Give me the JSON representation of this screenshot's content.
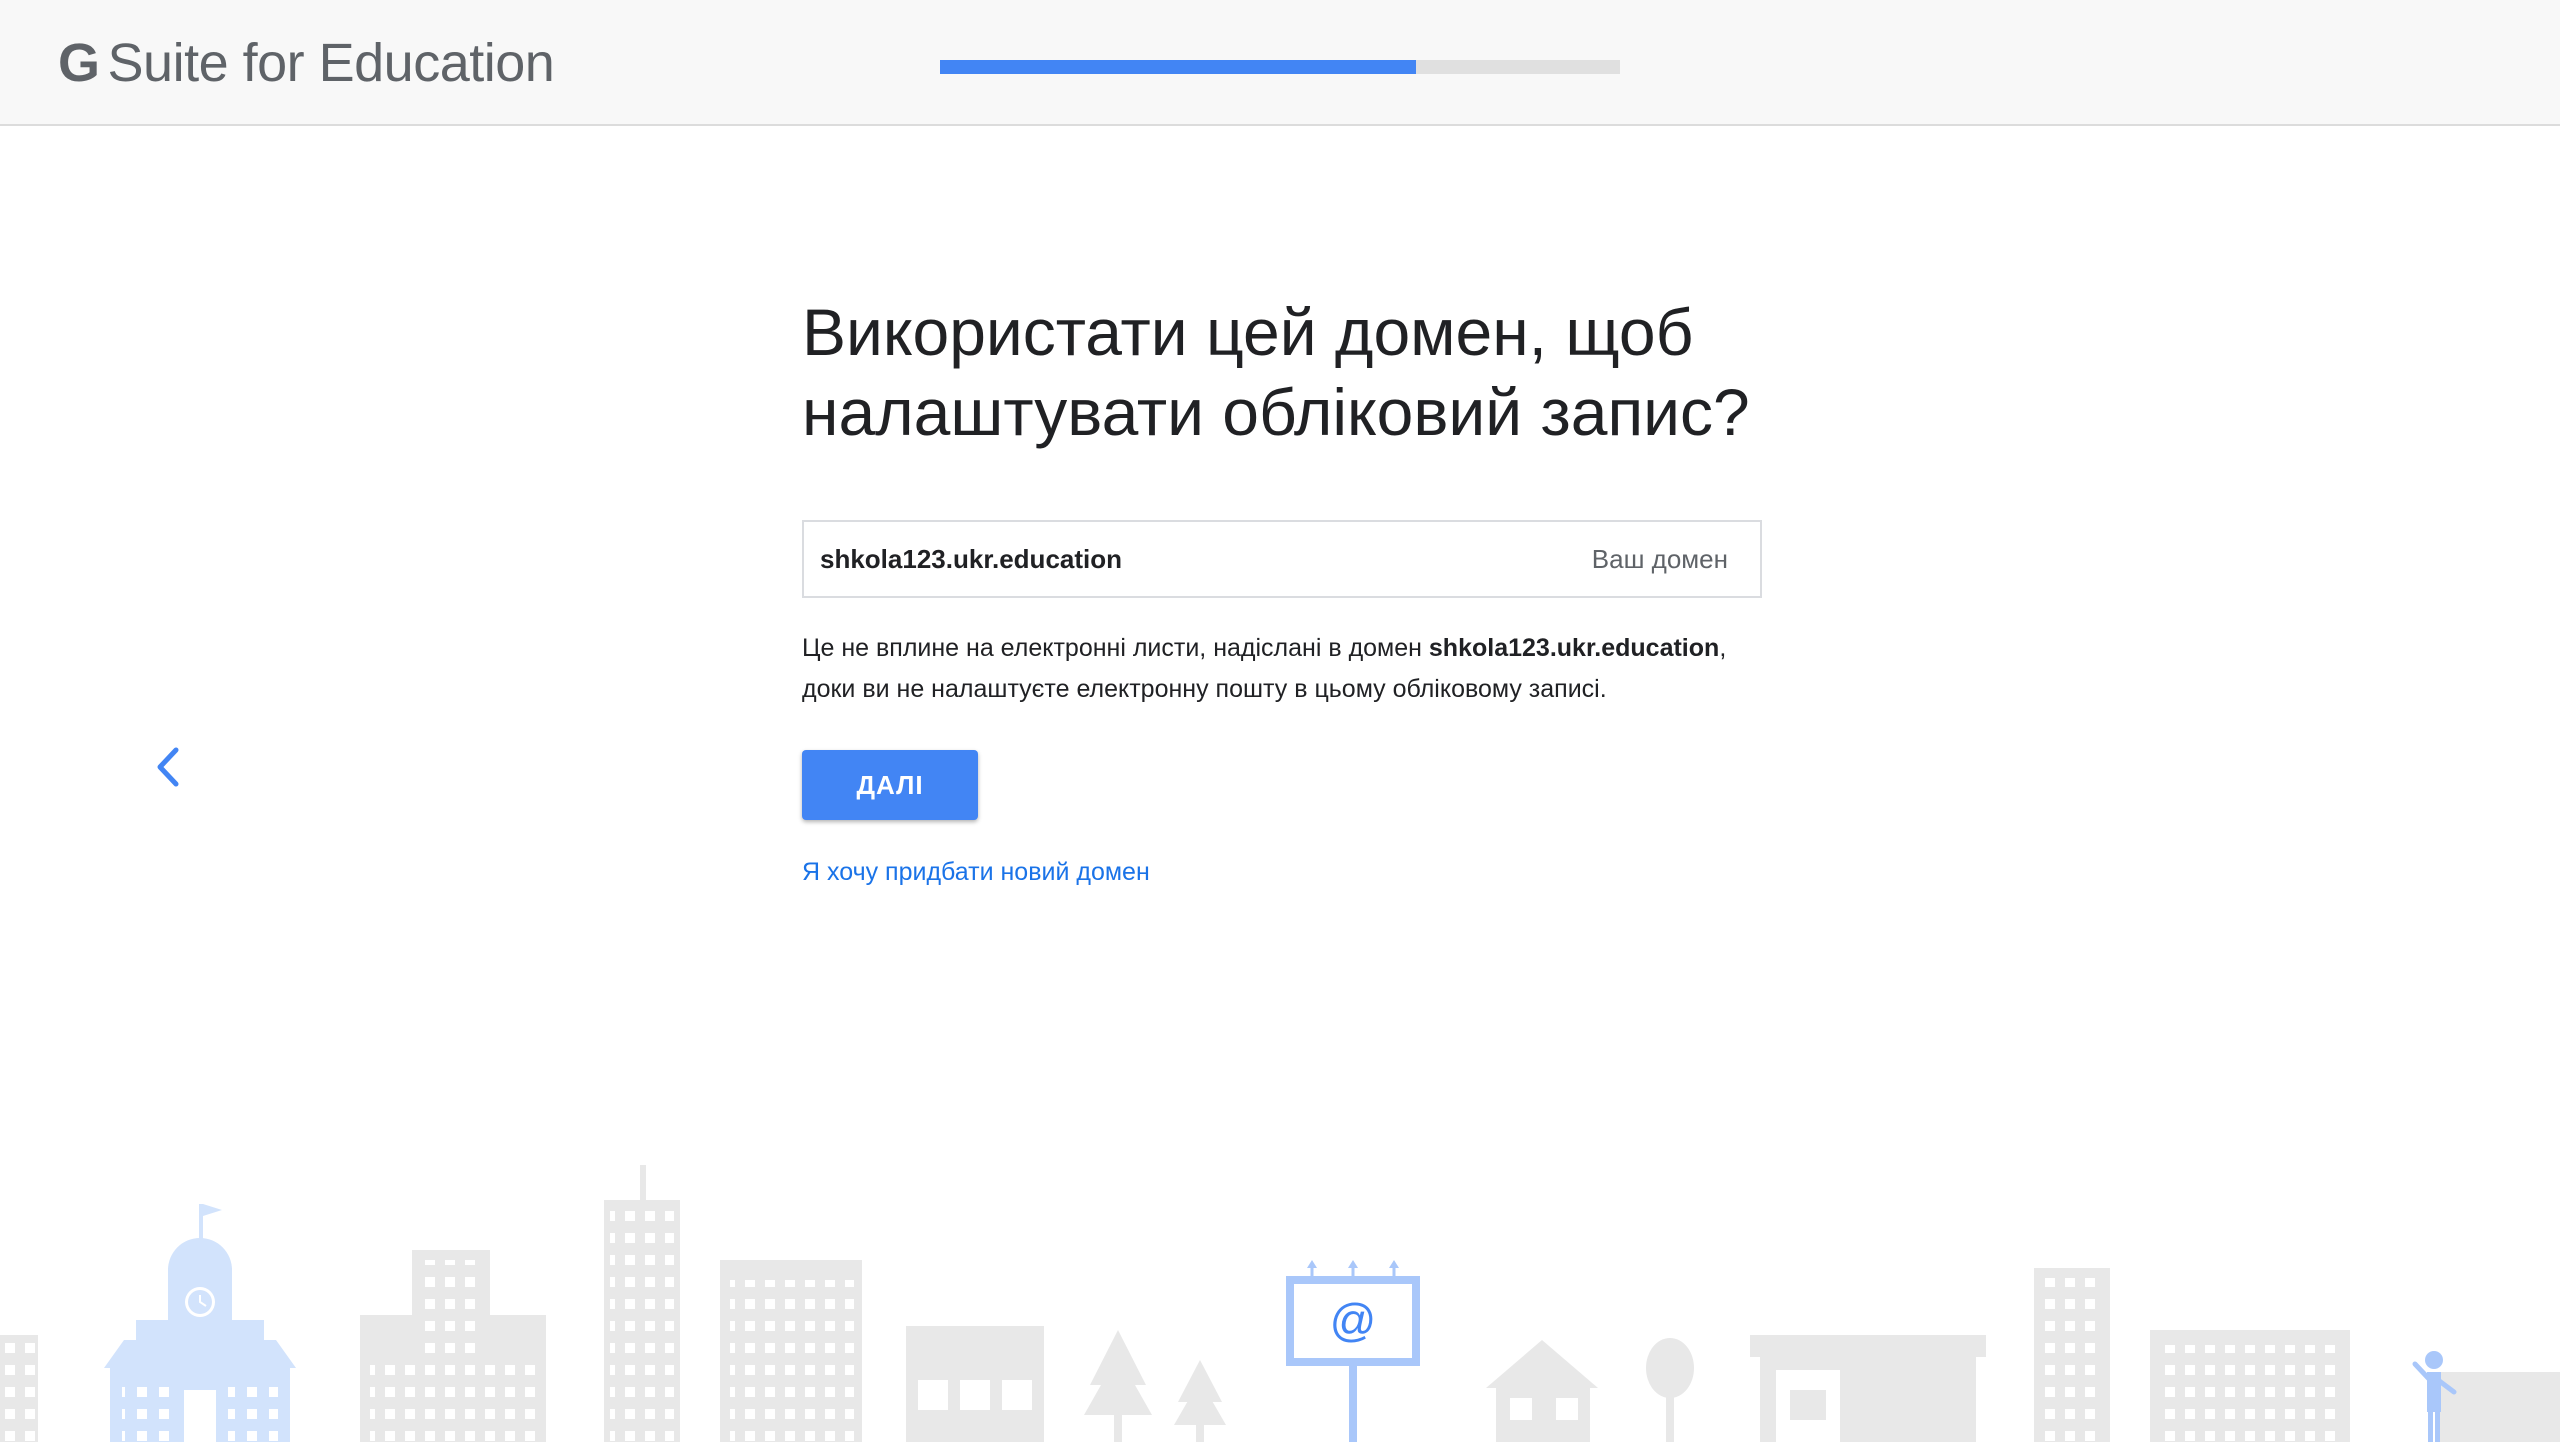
{
  "header": {
    "logo_g": "G",
    "logo_text": "Suite for Education",
    "progress": 0.7
  },
  "main": {
    "title": "Використати цей домен, щоб налаштувати обліковий запис?",
    "domain_value": "shkola123.ukr.education",
    "domain_suffix": "Ваш домен",
    "note_before": "Це не вплине на електронні листи, надіслані в домен ",
    "note_domain": "shkola123.ukr.education",
    "note_after": ", доки ви не налаштуєте електронну пошту в цьому обліковому записі.",
    "next_button": "ДАЛІ",
    "buy_domain_link": "Я хочу придбати новий домен"
  },
  "illustration": {
    "billboard_symbol": "@"
  },
  "colors": {
    "accent": "#4285f4",
    "link": "#1a73e8",
    "building_gray": "#e8e8e8",
    "building_blue": "#d2e3fc"
  },
  "icons": {
    "back": "chevron-left-icon"
  }
}
